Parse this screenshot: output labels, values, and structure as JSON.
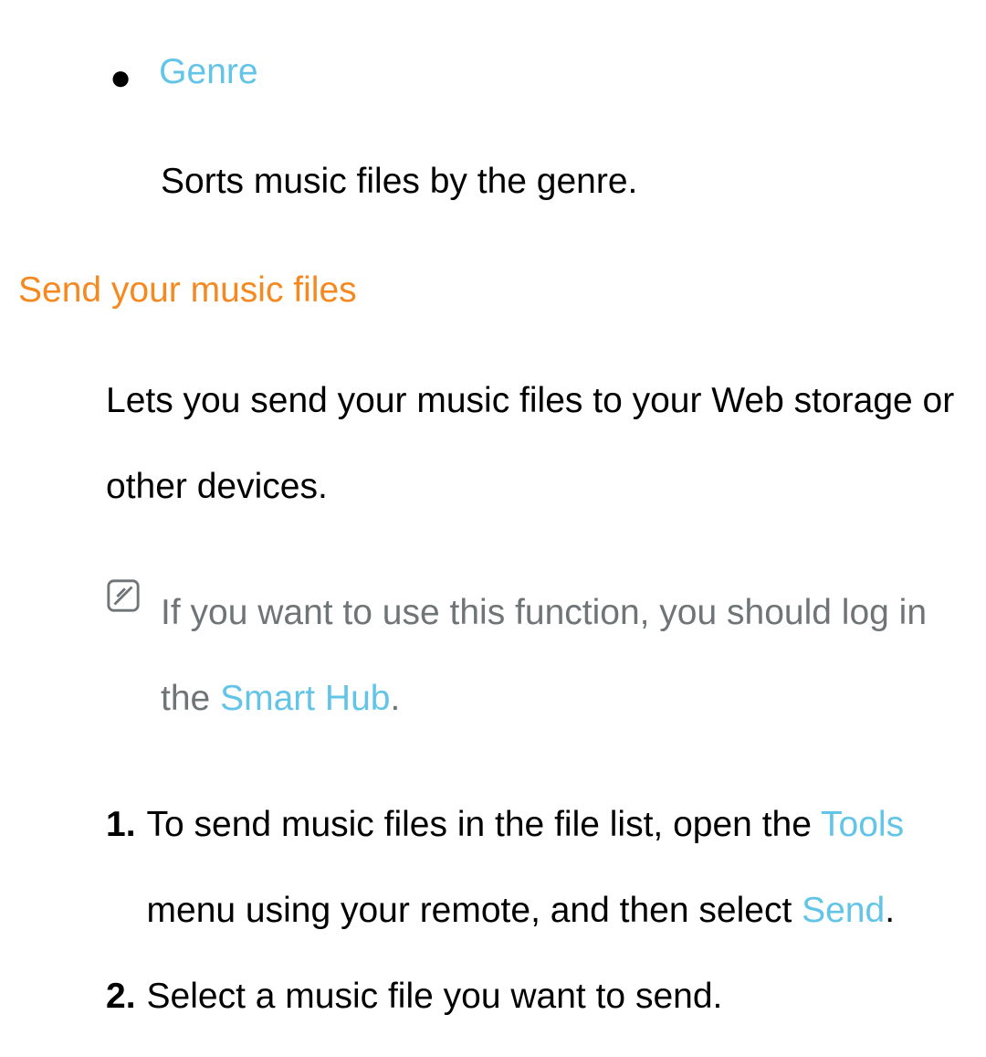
{
  "bullet": {
    "title": "Genre",
    "desc": "Sorts music files by the genre."
  },
  "section": {
    "heading": "Send your music files",
    "intro": "Lets you send your music files to your Web storage or other devices.",
    "note_part1": "If you want to use this function, you should log in the ",
    "note_link": "Smart Hub",
    "note_part2": ".",
    "steps": [
      {
        "num": "1.",
        "t1": "To send music files in the file list, open the ",
        "link1": "Tools",
        "t2": " menu using your remote, and then select ",
        "link2": "Send",
        "t3": "."
      },
      {
        "num": "2.",
        "t1": "Select a music file you want to send."
      }
    ]
  }
}
